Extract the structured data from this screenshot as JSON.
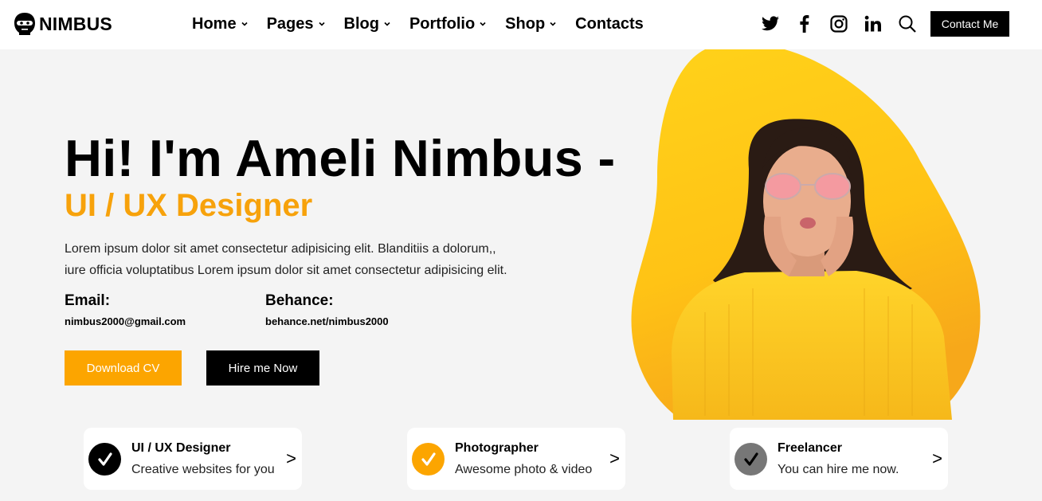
{
  "brand": {
    "name": "NIMBUS",
    "accent": "#fca500",
    "accent_text": "#f7a20b"
  },
  "nav": {
    "items": [
      {
        "label": "Home",
        "has_dropdown": true
      },
      {
        "label": "Pages",
        "has_dropdown": true
      },
      {
        "label": "Blog",
        "has_dropdown": true
      },
      {
        "label": "Portfolio",
        "has_dropdown": true
      },
      {
        "label": "Shop",
        "has_dropdown": true
      },
      {
        "label": "Contacts",
        "has_dropdown": false
      }
    ]
  },
  "social": {
    "icons": [
      "twitter-icon",
      "facebook-icon",
      "instagram-icon",
      "linkedin-icon",
      "search-icon"
    ]
  },
  "header": {
    "contact_label": "Contact Me"
  },
  "hero": {
    "title": "Hi! I'm Ameli Nimbus -",
    "subtitle": "UI / UX Designer",
    "description_line1": "Lorem ipsum dolor sit amet consectetur adipisicing elit. Blanditiis a dolorum,,",
    "description_line2": "iure officia voluptatibus Lorem ipsum dolor sit amet consectetur adipisicing elit.",
    "email_label": "Email:",
    "email_value": "nimbus2000@gmail.com",
    "behance_label": "Behance:",
    "behance_value": "behance.net/nimbus2000",
    "download_label": "Download CV",
    "hire_label": "Hire me Now"
  },
  "cards": [
    {
      "title": "UI / UX Designer",
      "text": "Creative websites for you",
      "arrow": ">",
      "badge_color": "#000000"
    },
    {
      "title": "Photographer",
      "text": "Awesome photo & video",
      "arrow": ">",
      "badge_color": "#fca500"
    },
    {
      "title": "Freelancer",
      "text": "You can hire me now.",
      "arrow": ">",
      "badge_color": "#777777"
    }
  ]
}
